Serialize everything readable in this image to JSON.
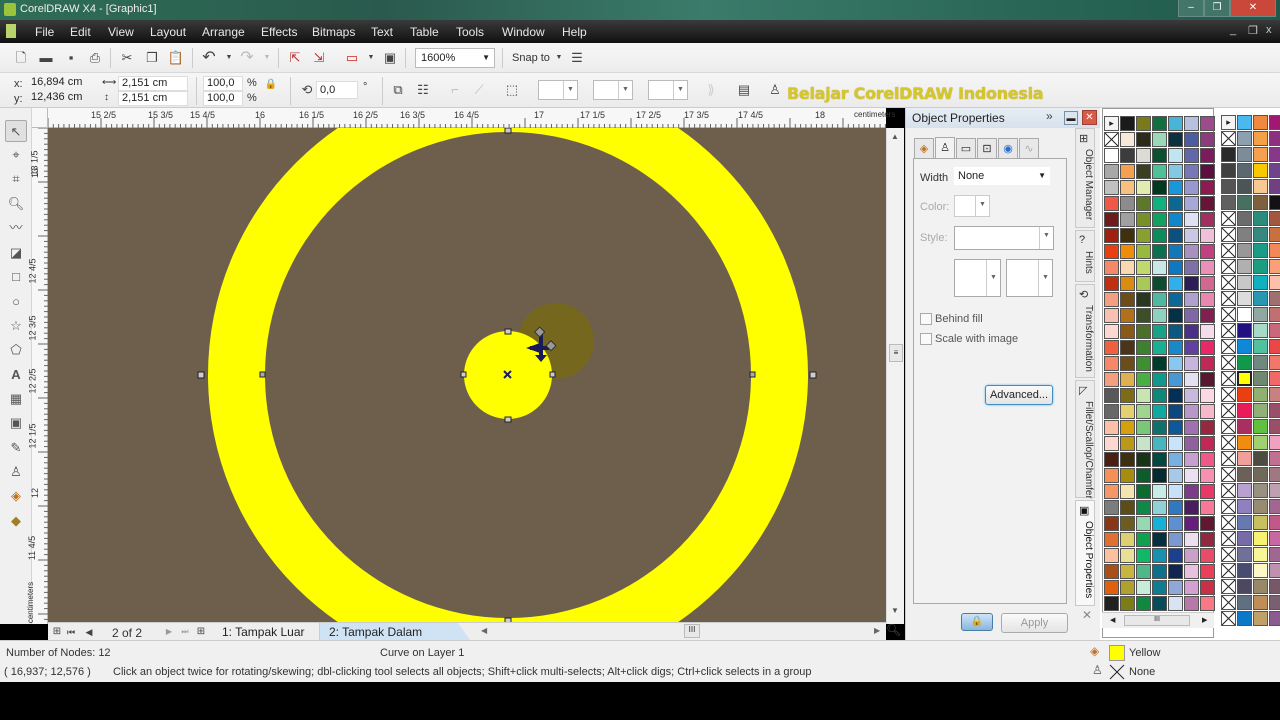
{
  "window": {
    "title": "CorelDRAW X4 - [Graphic1]",
    "controls": {
      "minimize": "‒",
      "restore": "❐",
      "close": "✕"
    }
  },
  "menu": {
    "items": [
      "File",
      "Edit",
      "View",
      "Layout",
      "Arrange",
      "Effects",
      "Bitmaps",
      "Text",
      "Table",
      "Tools",
      "Window",
      "Help"
    ],
    "doc_controls": {
      "minimize": "_",
      "restore": "❐",
      "close": "x"
    }
  },
  "standard_toolbar": {
    "icons": [
      "new-icon",
      "open-icon",
      "save-icon",
      "print-icon",
      "cut-icon",
      "copy-icon",
      "paste-icon",
      "undo-icon",
      "redo-icon",
      "import-icon",
      "export-icon",
      "application-launcher-icon",
      "welcome-screen-icon"
    ],
    "zoom_level": "1600%",
    "snap_to_label": "Snap to"
  },
  "property_bar": {
    "x_label": "x:",
    "x_value": "16,894 cm",
    "y_label": "y:",
    "y_value": "12,436 cm",
    "width_value": "2,151 cm",
    "height_value": "2,151 cm",
    "scale_x": "100,0",
    "scale_y": "100,0",
    "percent": "%",
    "rotation": "0,0",
    "degree": "°"
  },
  "watermark": "Belajar CorelDRAW Indonesia",
  "rulers": {
    "horizontal_ticks": [
      "15 2/5",
      "15 3/5",
      "15 4/5",
      "16",
      "16 1/5",
      "16 2/5",
      "16 3/5",
      "16 4/5",
      "17",
      "17 1/5",
      "17 2/5",
      "17 3/5",
      "17 4/5",
      "18"
    ],
    "unit": "centimeters",
    "vertical_ticks": [
      "13 1/5",
      "13",
      "12 4/5",
      "12 3/5",
      "12 2/5",
      "12 1/5",
      "12",
      "11 4/5"
    ]
  },
  "toolbox": {
    "tools": [
      "pick-tool",
      "shape-tool",
      "crop-tool",
      "zoom-tool",
      "freehand-tool",
      "smart-fill-tool",
      "rectangle-tool",
      "ellipse-tool",
      "polygon-tool",
      "basic-shapes-tool",
      "text-tool",
      "table-tool",
      "interactive-effects-tool",
      "eyedropper-tool",
      "outline-tool",
      "fill-tool",
      "interactive-fill-tool"
    ]
  },
  "canvas": {
    "background": "#6d5f4c",
    "ring_color": "#ffff00",
    "inner_circle_color": "#ffff00",
    "ghost_color": "#7a6a10"
  },
  "page_nav": {
    "counter": "2 of 2",
    "tabs": [
      {
        "label": "1: Tampak Luar",
        "active": false
      },
      {
        "label": "2: Tampak Dalam",
        "active": true
      }
    ]
  },
  "docker": {
    "title": "Object Properties",
    "tabs": [
      "fill-tab",
      "outline-tab",
      "general-tab",
      "detail-tab",
      "internet-tab",
      "curve-tab"
    ],
    "width_label": "Width",
    "width_value": "None",
    "color_label": "Color:",
    "style_label": "Style:",
    "behind_fill_label": "Behind fill",
    "behind_fill_checked": false,
    "scale_with_image_label": "Scale with image",
    "scale_with_image_checked": false,
    "advanced_label": "Advanced...",
    "apply_label": "Apply",
    "side_tabs": [
      "Object Manager",
      "Hints",
      "Transformation",
      "Fillet/Scallop/Chamfer",
      "Object Properties"
    ]
  },
  "status": {
    "nodes": "Number of Nodes: 12",
    "object_info": "Curve on Layer 1",
    "coords": "( 16,937; 12,576 )",
    "hint": "Click an object twice for rotating/skewing; dbl-clicking tool selects all objects; Shift+click multi-selects; Alt+click digs; Ctrl+click selects in a group",
    "fill_name": "Yellow",
    "fill_color": "#ffff00",
    "outline_name": "None"
  },
  "palette": {
    "col1": [
      [
        "#1a1a1a",
        "#7a7a1c",
        "#127040",
        "#4ab4d8",
        "#b8c0e0",
        "#9c4c8c"
      ],
      [
        "#f8e8d8",
        "#2e2a1a",
        "#9cd8b8",
        "#0c3040",
        "#4c5ca0",
        "#8c3c7c"
      ],
      [
        "#ffffff",
        "#3c3c3c",
        "#dcdcd4",
        "#0c5030",
        "#c0e4f0",
        "#6068a8",
        "#7c1c5c"
      ],
      [
        "#a8a8a8",
        "#f4a050",
        "#384020",
        "#50c098",
        "#84c8e4",
        "#7878b8",
        "#5c1040"
      ],
      [
        "#c0c0c0",
        "#f8c080",
        "#e0ecb0",
        "#003820",
        "#1898d8",
        "#9898d0",
        "#8c1c50"
      ],
      [
        "#f05848",
        "#8c8c8c",
        "#5c7828",
        "#10b080",
        "#0c6890",
        "#a8a8d8",
        "#681438"
      ],
      [
        "#6c1c1c",
        "#a0a0a0",
        "#789028",
        "#10a060",
        "#1088c8",
        "#e0e0f4",
        "#a03060"
      ],
      [
        "#a02010",
        "#40300c",
        "#88a030",
        "#0c8c5c",
        "#0c5080",
        "#c8c8e4",
        "#f0c0d8"
      ],
      [
        "#e84010",
        "#f08c0c",
        "#98b840",
        "#0c7050",
        "#1478b8",
        "#a890c0",
        "#c04080"
      ],
      [
        "#f48868",
        "#f8d8b0",
        "#c0d870",
        "#c8e8e8",
        "#1078c0",
        "#8070a8",
        "#e890b8"
      ],
      [
        "#c03010",
        "#d88c10",
        "#a8c858",
        "#0c4c30",
        "#30b0e8",
        "#2c1c58",
        "#d06890"
      ],
      [
        "#f4a080",
        "#6c4c18",
        "#283820",
        "#50b8a0",
        "#0c6898",
        "#b0a0d0",
        "#e888b0"
      ],
      [
        "#f8c0b0",
        "#b47018",
        "#3c5028",
        "#90d0c0",
        "#043048",
        "#8068a8",
        "#802050"
      ],
      [
        "#fcd8d0",
        "#8c5818",
        "#4c7028",
        "#18a088",
        "#0c5880",
        "#4c3088",
        "#f4dcec"
      ],
      [
        "#f06040",
        "#4c3418",
        "#3c8030",
        "#18b090",
        "#1888c8",
        "#6040a0",
        "#e82868"
      ],
      [
        "#f48868",
        "#6c4c18",
        "#3c9030",
        "#003c2c",
        "#88c8f0",
        "#c8b4dc",
        "#c02858"
      ],
      [
        "#f4a080",
        "#e0b050",
        "#48b040",
        "#10988c",
        "#4898d8",
        "#e4e0f0",
        "#581830"
      ],
      [
        "#585858",
        "#7c6c18",
        "#c8e4b0",
        "#108878",
        "#043058",
        "#c8b8dc",
        "#fcd8e4"
      ],
      [
        "#686868",
        "#e4d070",
        "#a0d490",
        "#10a8a0",
        "#0c4880",
        "#b898c8",
        "#f8b8cc"
      ],
      [
        "#fcc0a8",
        "#d4a010",
        "#78c878",
        "#10706c",
        "#0c5898",
        "#a070b0",
        "#982840"
      ],
      [
        "#fcd8d0",
        "#bc9818",
        "#c8e4c8",
        "#48b4c0",
        "#c8e4fc",
        "#9060a0",
        "#c02858"
      ],
      [
        "#4c2010",
        "#3c3010",
        "#183418",
        "#004840",
        "#78b0e0",
        "#c8a0d0",
        "#f05888"
      ],
      [
        "#f49058",
        "#a88c10",
        "#0c5c2c",
        "#042c30",
        "#a8c8e8",
        "#ece0f0",
        "#f890b0"
      ],
      [
        "#f49868",
        "#f4e4b0",
        "#0c6c30",
        "#c8ece8",
        "#c8e0f8",
        "#7c3c88",
        "#e83868"
      ],
      [
        "#7c7c7c",
        "#5c4c18",
        "#108848",
        "#90d0d8",
        "#3078c0",
        "#4c1c60",
        "#f87898"
      ],
      [
        "#883818",
        "#6c5c20",
        "#98d8b0",
        "#18b0d8",
        "#5c90d0",
        "#681c7c",
        "#601830"
      ],
      [
        "#e07030",
        "#dcd070",
        "#10a050",
        "#043040",
        "#7c98d0",
        "#ece0f0",
        "#902840"
      ],
      [
        "#fcc0a0",
        "#e8e098",
        "#10b868",
        "#1890b0",
        "#1c4090",
        "#c8a0c8",
        "#e84c68"
      ],
      [
        "#a85018",
        "#c8b440",
        "#50b888",
        "#10708c",
        "#142450",
        "#e8c0e0",
        "#e84058"
      ],
      [
        "#e06010",
        "#b0a030",
        "#c8ecd8",
        "#107c90",
        "#90a8d8",
        "#d4a0d0",
        "#c83048"
      ],
      [
        "#202020",
        "#7c7c18",
        "#108840",
        "#084c5c",
        "#d8e4f4",
        "#b878a8",
        "#f87888"
      ]
    ],
    "col2": [
      [
        "#4cb8f0",
        "#f08840",
        "#a01870"
      ],
      [
        "#8ca0b0",
        "#f4a048",
        "#8c3080"
      ],
      [
        "#2a2a2a",
        "#7c8c98",
        "#f4a050",
        "#883888"
      ],
      [
        "#404040",
        "#5c6870",
        "#f8c800",
        "#704488"
      ],
      [
        "#545454",
        "#4c5458",
        "#f8c890",
        "#704080"
      ],
      [
        "#606060",
        "#487060",
        "#7c6040",
        "#141014"
      ],
      [
        "#6c6c6c",
        "#2c8c7c",
        "#a05840"
      ],
      [
        "#808080",
        "#388880",
        "#c87040"
      ],
      [
        "#989898",
        "#1c9c88",
        "#f08858"
      ],
      [
        "#b0b0b0",
        "#1c9c80",
        "#f8a078"
      ],
      [
        "#c8c8c8",
        "#10b0c0",
        "#fcc0a8"
      ],
      [
        "#dcdcdc",
        "#2898b0",
        "#a07070"
      ],
      [
        "#ffffff",
        "#90a8a0",
        "#c07070"
      ],
      [
        "#201080",
        "#a8d8c8",
        "#c86878"
      ],
      [
        "#1088d8",
        "#50c0a0",
        "#e84848"
      ],
      [
        "#10984c",
        "#708880",
        "#f07868"
      ],
      [
        "#ffff00",
        "#708870",
        "#f06868"
      ],
      [
        "#e84010",
        "#90b070",
        "#c88080"
      ],
      [
        "#e81c58",
        "#90b078",
        "#985068"
      ],
      [
        "#a83060",
        "#60c040",
        "#985068"
      ],
      [
        "#f08c10",
        "#a0d070",
        "#f0a0c0"
      ],
      [
        "#f0a098",
        "#4c4c40",
        "#c07090"
      ],
      [
        "#6c6058",
        "#706858",
        "#a07880"
      ],
      [
        "#b8a0d0",
        "#989080",
        "#c0a0b0"
      ],
      [
        "#9080c0",
        "#988c70",
        "#a06890"
      ],
      [
        "#6878b0",
        "#c8c060",
        "#c05888"
      ],
      [
        "#786ca8",
        "#f8f070",
        "#c868a0"
      ],
      [
        "#707098",
        "#f8f498",
        "#a06890"
      ],
      [
        "#484c70",
        "#fcf8c8",
        "#c090b0"
      ],
      [
        "#4c4860",
        "#988868",
        "#785868"
      ],
      [
        "#607080",
        "#c08c58",
        "#786070"
      ],
      [
        "#0c78c8",
        "#c0a068",
        "#8c5c90"
      ]
    ]
  }
}
